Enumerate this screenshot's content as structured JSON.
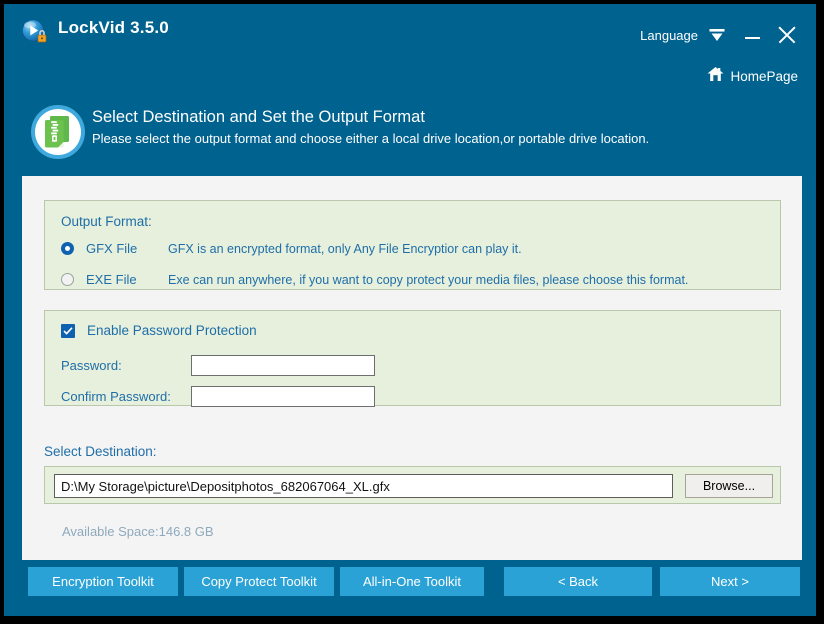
{
  "window": {
    "app_icon": "lock-video-icon",
    "title": "LockVid 3.5.0",
    "language_label": "Language",
    "language_dropdown_icon": "chevron-down-icon",
    "minimize_icon": "minimize-icon",
    "close_icon": "close-icon",
    "homepage_label": "HomePage",
    "homepage_icon": "home-icon"
  },
  "header": {
    "icon": "zip-archive-icon",
    "title": "Select Destination and Set the Output Format",
    "subtitle": "Please select the output format and choose either a local drive location,or portable drive location."
  },
  "output_format": {
    "section_label": "Output Format:",
    "options": [
      {
        "label": "GFX File",
        "description": "GFX is an encrypted format, only Any File Encryptior can play it.",
        "selected": true
      },
      {
        "label": "EXE File",
        "description": "Exe can run anywhere, if you want to copy protect your media files, please choose this format.",
        "selected": false
      }
    ]
  },
  "password": {
    "enable_label": "Enable Password Protection",
    "enabled": true,
    "checkbox_icon": "checkmark-icon",
    "password_label": "Password:",
    "password_value": "",
    "confirm_label": "Confirm Password:",
    "confirm_value": ""
  },
  "destination": {
    "section_label": "Select Destination:",
    "path_value": "D:\\My Storage\\picture\\Depositphotos_682067064_XL.gfx",
    "browse_label": "Browse...",
    "available_space": "Available Space:146.8 GB"
  },
  "footer": {
    "encryption_toolkit": "Encryption Toolkit",
    "copy_protect_toolkit": "Copy Protect Toolkit",
    "all_in_one_toolkit": "All-in-One Toolkit",
    "back": "< Back",
    "next": "Next >"
  },
  "colors": {
    "window_chrome": "#00628f",
    "panel_background": "#f4f4f4",
    "group_background": "#e6f0dd",
    "accent_text": "#1f6ea8",
    "button_blue": "#2aa2d6",
    "radio_blue": "#0f62b0",
    "muted_text": "#8fa9bd"
  }
}
